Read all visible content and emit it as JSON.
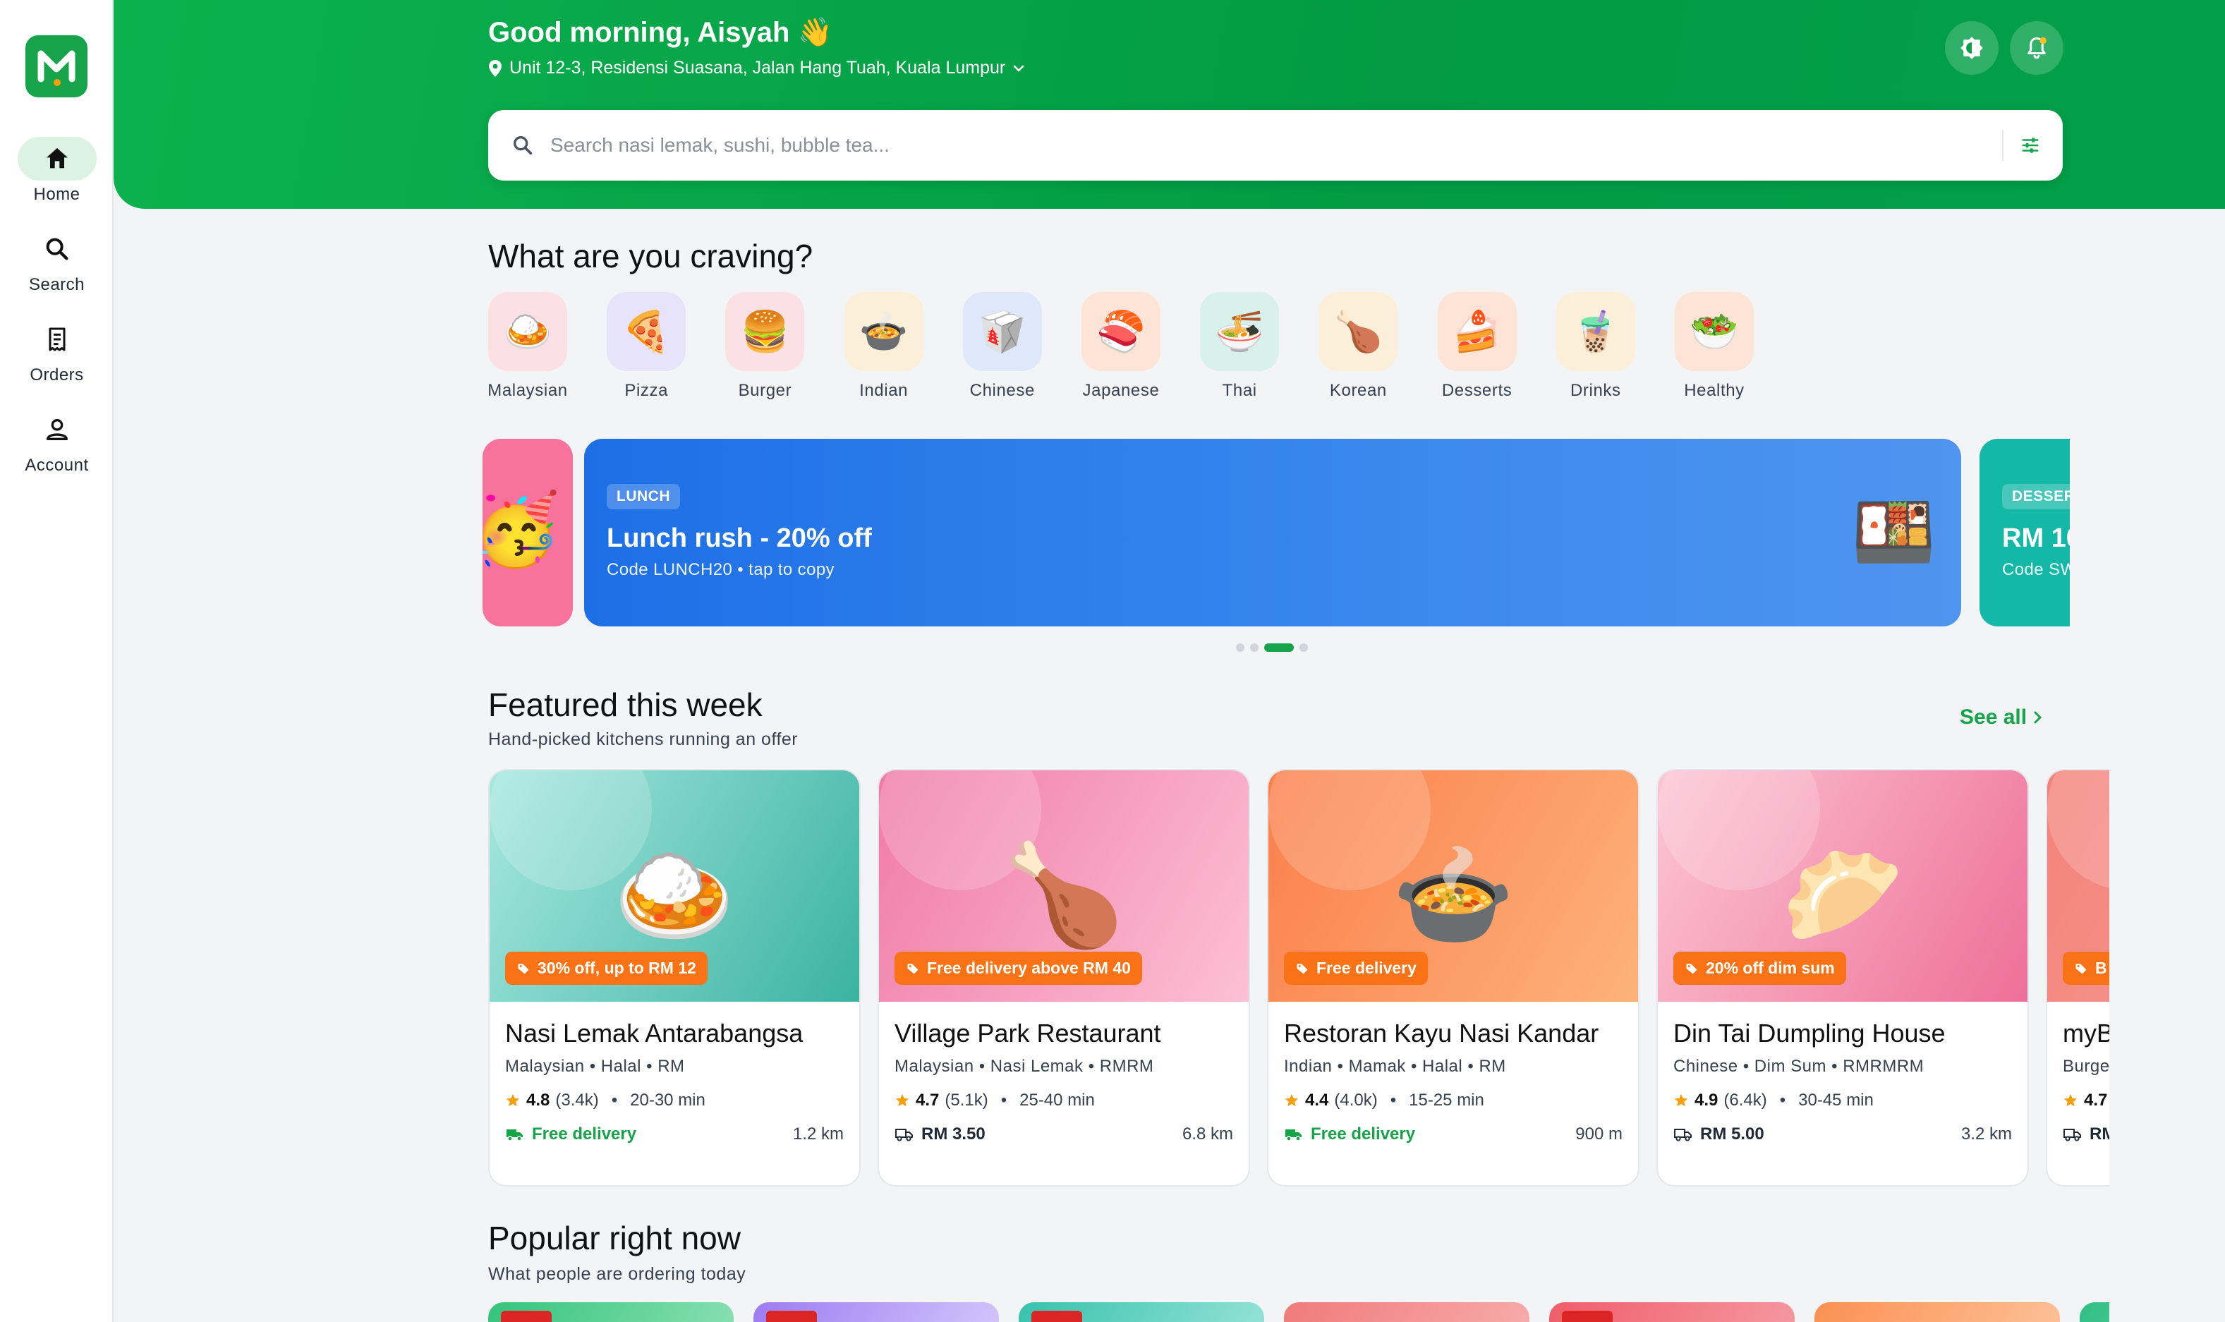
{
  "sidebar": {
    "logo_letter": "M",
    "items": [
      {
        "label": "Home",
        "icon": "home-icon",
        "active": true
      },
      {
        "label": "Search",
        "icon": "search-icon",
        "active": false
      },
      {
        "label": "Orders",
        "icon": "receipt-icon",
        "active": false
      },
      {
        "label": "Account",
        "icon": "user-icon",
        "active": false
      }
    ]
  },
  "header": {
    "greeting": "Good morning, Aisyah 👋",
    "address": "Unit 12-3, Residensi Suasana, Jalan Hang Tuah, Kuala Lumpur",
    "search_placeholder": "Search nasi lemak, sushi, bubble tea...",
    "theme_icon": "contrast-icon",
    "notification_icon": "bell-icon",
    "has_unread_notifications": true
  },
  "craving": {
    "title": "What are you craving?",
    "categories": [
      {
        "label": "Malaysian",
        "emoji": "🍛",
        "bg": "#fbe1e6"
      },
      {
        "label": "Pizza",
        "emoji": "🍕",
        "bg": "#e6e3fb"
      },
      {
        "label": "Burger",
        "emoji": "🍔",
        "bg": "#fbe1e6"
      },
      {
        "label": "Indian",
        "emoji": "🍲",
        "bg": "#fbefd9"
      },
      {
        "label": "Chinese",
        "emoji": "🥡",
        "bg": "#dfe8fb"
      },
      {
        "label": "Japanese",
        "emoji": "🍣",
        "bg": "#fde4d6"
      },
      {
        "label": "Thai",
        "emoji": "🍜",
        "bg": "#d8f1ea"
      },
      {
        "label": "Korean",
        "emoji": "🍗",
        "bg": "#fbefd9"
      },
      {
        "label": "Desserts",
        "emoji": "🍰",
        "bg": "#fde4d6"
      },
      {
        "label": "Drinks",
        "emoji": "🧋",
        "bg": "#fbefd9"
      },
      {
        "label": "Healthy",
        "emoji": "🥗",
        "bg": "#fde4d6"
      }
    ]
  },
  "promos": {
    "left_emoji": "🥳",
    "main": {
      "tag": "LUNCH",
      "title": "Lunch rush - 20% off",
      "subtitle": "Code LUNCH20 • tap to copy",
      "emoji": "🍱"
    },
    "next": {
      "tag": "DESSER",
      "title": "RM 10",
      "subtitle": "Code SW"
    },
    "dot_count": 4,
    "active_dot": 2
  },
  "featured": {
    "title": "Featured this week",
    "subtitle": "Hand-picked kitchens running an offer",
    "see_all": "See all",
    "cards": [
      {
        "name": "Nasi Lemak Antarabangsa",
        "meta": "Malaysian • Halal • RM",
        "badge": "30% off, up to RM 12",
        "emoji": "🍛",
        "rating": "4.8",
        "reviews": "(3.4k)",
        "time": "20-30 min",
        "fee": "Free delivery",
        "fee_free": true,
        "distance": "1.2 km",
        "grad_from": "#a6e7df",
        "grad_to": "#3bb3a2"
      },
      {
        "name": "Village Park Restaurant",
        "meta": "Malaysian • Nasi Lemak • RMRM",
        "badge": "Free delivery above RM 40",
        "emoji": "🍗",
        "rating": "4.7",
        "reviews": "(5.1k)",
        "time": "25-40 min",
        "fee": "RM 3.50",
        "fee_free": false,
        "distance": "6.8 km",
        "grad_from": "#f07ba6",
        "grad_to": "#fcc0d4"
      },
      {
        "name": "Restoran Kayu Nasi Kandar",
        "meta": "Indian • Mamak • Halal • RM",
        "badge": "Free delivery",
        "emoji": "🍲",
        "rating": "4.4",
        "reviews": "(4.0k)",
        "time": "15-25 min",
        "fee": "Free delivery",
        "fee_free": true,
        "distance": "900 m",
        "grad_from": "#fb7f4a",
        "grad_to": "#fdb27c"
      },
      {
        "name": "Din Tai Dumpling House",
        "meta": "Chinese • Dim Sum • RMRMRM",
        "badge": "20% off dim sum",
        "emoji": "🥟",
        "rating": "4.9",
        "reviews": "(6.4k)",
        "time": "30-45 min",
        "fee": "RM 5.00",
        "fee_free": false,
        "distance": "3.2 km",
        "grad_from": "#fcc5d6",
        "grad_to": "#ee6f99"
      },
      {
        "name": "myB",
        "meta": "Burge",
        "badge": "B",
        "emoji": "",
        "rating": "4.7",
        "reviews": "",
        "time": "",
        "fee": "RM",
        "fee_free": false,
        "distance": "",
        "grad_from": "#f3827a",
        "grad_to": "#f7a49c"
      }
    ]
  },
  "popular": {
    "title": "Popular right now",
    "subtitle": "What people are ordering today",
    "cards": [
      {
        "grad_from": "#34c47c",
        "grad_to": "#8be0b4",
        "tag": true
      },
      {
        "grad_from": "#9b7cf2",
        "grad_to": "#d6c7fb",
        "tag": true
      },
      {
        "grad_from": "#37c2ad",
        "grad_to": "#97e3d7",
        "tag": true
      },
      {
        "grad_from": "#f07a7a",
        "grad_to": "#f7adac",
        "tag": false
      },
      {
        "grad_from": "#ef5d6a",
        "grad_to": "#f59aa2",
        "tag": true
      },
      {
        "grad_from": "#fb9052",
        "grad_to": "#fdc29a",
        "tag": false
      },
      {
        "grad_from": "#2fbf84",
        "grad_to": "#8ee4c0",
        "tag": false
      }
    ]
  },
  "colors": {
    "brand": "#16a34a",
    "badge": "#f97316",
    "promo_blue": "#1f78ea",
    "promo_pink": "#f7729d",
    "promo_teal": "#14b8a6"
  }
}
